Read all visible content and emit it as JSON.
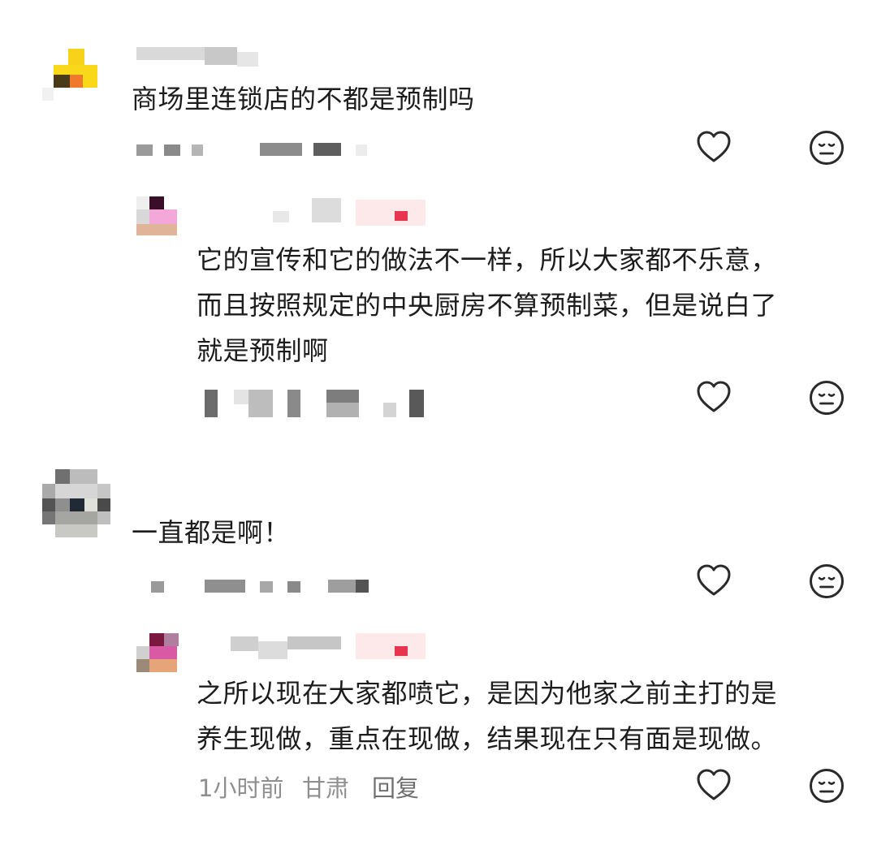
{
  "comments": [
    {
      "text": "商场里连锁店的不都是预制吗",
      "reply": {
        "lines": [
          "它的宣传和它的做法不一样，所以大家都不乐意，",
          "而且按照规定的中央厨房不算预制菜，但是说白了",
          "就是预制啊"
        ]
      }
    },
    {
      "text": "一直都是啊！",
      "reply": {
        "lines": [
          "之所以现在大家都喷它，是因为他家之前主打的是",
          "养生现做，重点在现做，结果现在只有面是现做。"
        ],
        "time": "1小时前",
        "location": "甘肃",
        "reply_label": "回复"
      }
    }
  ],
  "icons": {
    "like": "heart-icon",
    "dislike": "meh-face-icon"
  },
  "colors": {
    "text": "#1c1c1c",
    "meta": "#8f8f8f",
    "icon": "#2a2a2a",
    "badge": "#e8344e"
  }
}
